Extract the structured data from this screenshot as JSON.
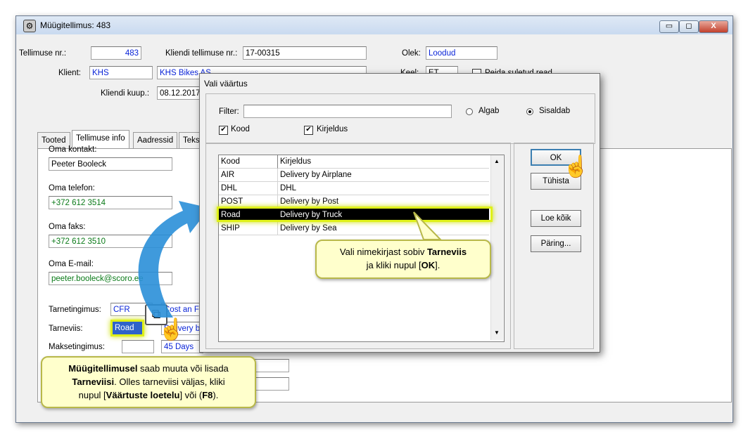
{
  "window": {
    "title": "Müügitellimus: 483",
    "controls": {
      "minimize": "▭",
      "maximize": "◻",
      "close": "X"
    }
  },
  "header": {
    "order_no_label": "Tellimuse nr.:",
    "order_no": "483",
    "client_order_label": "Kliendi tellimuse nr.:",
    "client_order": "17-00315",
    "status_label": "Olek:",
    "status": "Loodud",
    "client_label": "Klient:",
    "client_code": "KHS",
    "client_name": "KHS Bikes AS",
    "lang_label": "Keel:",
    "lang": "ET",
    "hide_closed_label": "Peida suletud read",
    "client_date_label": "Kliendi kuup.:",
    "client_date": "08.12.2017"
  },
  "tabs": [
    "Tooted",
    "Tellimuse info",
    "Aadressid",
    "Tekst"
  ],
  "form": {
    "contact_label": "Oma kontakt:",
    "contact": "Peeter Booleck",
    "phone_label": "Oma telefon:",
    "phone": "+372 612 3514",
    "fax_label": "Oma faks:",
    "fax": "+372 612 3510",
    "email_label": "Oma E-mail:",
    "email": "peeter.booleck@scoro.ee",
    "delivery_term_label": "Tarnetingimus:",
    "delivery_term_code": "CFR",
    "delivery_term_desc": "Cost an Fr",
    "shipping_label": "Tarneviis:",
    "shipping_code": "Road",
    "shipping_desc": "Delivery by",
    "payment_label": "Maksetingimus:",
    "payment_desc": "45 Days"
  },
  "dialog": {
    "title": "Vali väärtus",
    "filter_label": "Filter:",
    "filter_value": "",
    "radio_starts": "Algab",
    "radio_contains": "Sisaldab",
    "selected_mode": "contains",
    "check_code": "Kood",
    "check_desc": "Kirjeldus",
    "columns": [
      "Kood",
      "Kirjeldus"
    ],
    "rows": [
      {
        "code": "AIR",
        "desc": "Delivery by Airplane"
      },
      {
        "code": "DHL",
        "desc": "DHL"
      },
      {
        "code": "POST",
        "desc": "Delivery by Post"
      },
      {
        "code": "Road",
        "desc": "Delivery by Truck",
        "selected": true
      },
      {
        "code": "SHIP",
        "desc": "Delivery by Sea"
      }
    ],
    "buttons": {
      "ok": "OK",
      "cancel": "Tühista",
      "read_all": "Loe kõik",
      "query": "Päring..."
    }
  },
  "callouts": {
    "dialog_tip_pre": "Vali nimekirjast sobiv ",
    "dialog_tip_bold": "Tarneviis",
    "dialog_tip_mid": "ja kliki nupul [",
    "dialog_tip_ok": "OK",
    "dialog_tip_end": "].",
    "form_tip_1": "Müügitellimusel",
    "form_tip_2": " saab muuta või lisada",
    "form_tip_3": "Tarneviisi",
    "form_tip_4": ". Olles tarneviisi väljas, kliki",
    "form_tip_5": "nupul [",
    "form_tip_6": "Väärtuste loetelu",
    "form_tip_7": "] või (",
    "form_tip_8": "F8",
    "form_tip_9": ")."
  },
  "colors": {
    "selection": "#000000",
    "highlight": "#dff018",
    "callout_bg": "#ffffcc",
    "arrow": "#2a8fd8"
  },
  "icons": [
    "app-icon",
    "value-list-icon",
    "hand-pointer-icon"
  ]
}
